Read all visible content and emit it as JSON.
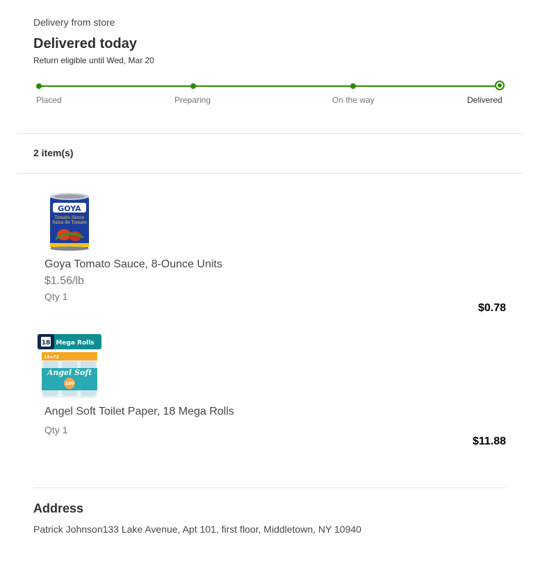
{
  "delivery": {
    "subtitle": "Delivery from store",
    "status_title": "Delivered today",
    "return_note": "Return eligible until Wed, Mar 20"
  },
  "tracker": {
    "color": "#2a8703",
    "steps": [
      {
        "label": "Placed"
      },
      {
        "label": "Preparing"
      },
      {
        "label": "On the way"
      },
      {
        "label": "Delivered",
        "current": true
      }
    ]
  },
  "items_summary": {
    "count_label": "2 item(s)"
  },
  "items": [
    {
      "name": "Goya Tomato Sauce, 8-Ounce Units",
      "unit_price": "$1.56/lb",
      "qty": "Qty 1",
      "price": "$0.78",
      "image_icon": "tomato-sauce-can-image",
      "image_text": {
        "brand": "GOYA",
        "line1": "Tomato Sauce",
        "line2": "Salsa de Tomate"
      }
    },
    {
      "name": "Angel Soft Toilet Paper, 18 Mega Rolls",
      "qty": "Qty 1",
      "price": "$11.88",
      "image_icon": "toilet-paper-pack-image",
      "image_text": {
        "count": "18",
        "banner": "Mega Rolls",
        "brand": "Angel Soft",
        "equiv": "18=72",
        "sheets": "320"
      }
    }
  ],
  "address": {
    "title": "Address",
    "text": "Patrick Johnson133 Lake Avenue, Apt 101, first floor, Middletown, NY 10940"
  }
}
